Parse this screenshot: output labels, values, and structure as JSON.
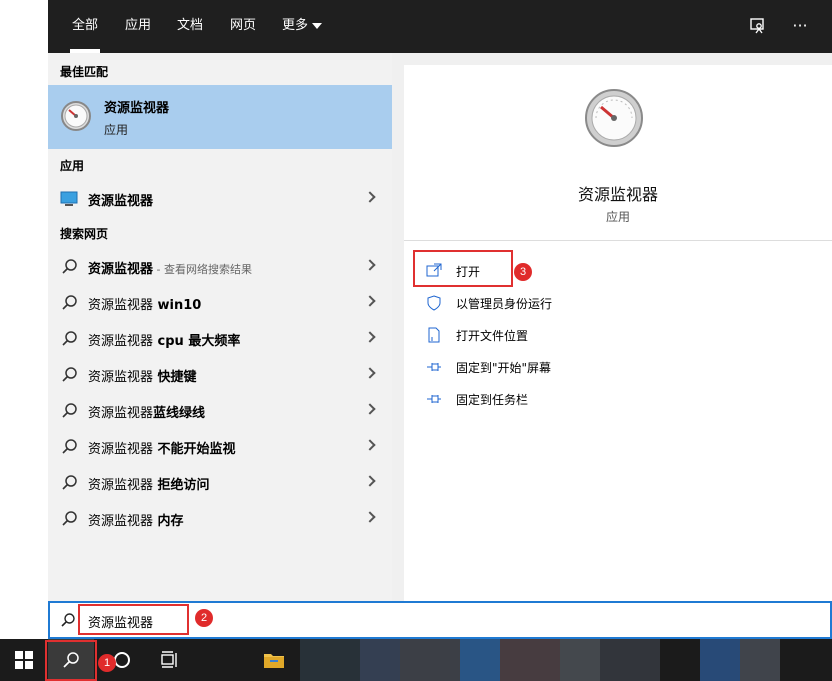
{
  "header": {
    "tabs": [
      {
        "label": "全部",
        "active": true
      },
      {
        "label": "应用"
      },
      {
        "label": "文档"
      },
      {
        "label": "网页"
      },
      {
        "label": "更多"
      }
    ],
    "feedback_icon": "feedback-icon",
    "more_icon": "ellipsis-icon",
    "more_glyph": "···"
  },
  "results": {
    "best_match_label": "最佳匹配",
    "best_match": {
      "title": "资源监视器",
      "subtitle": "应用",
      "icon": "gauge-icon"
    },
    "apps_label": "应用",
    "apps": [
      {
        "title": "资源监视器",
        "icon": "monitor-icon"
      }
    ],
    "web_label": "搜索网页",
    "web": [
      {
        "query": "资源监视器",
        "suffix": "",
        "hint": " - 查看网络搜索结果"
      },
      {
        "query": "资源监视器",
        "suffix": " win10",
        "hint": ""
      },
      {
        "query": "资源监视器",
        "suffix": " cpu 最大频率",
        "hint": ""
      },
      {
        "query": "资源监视器",
        "suffix": " 快捷键",
        "hint": ""
      },
      {
        "query": "资源监视器",
        "suffix": "蓝线绿线",
        "hint": ""
      },
      {
        "query": "资源监视器",
        "suffix": " 不能开始监视",
        "hint": ""
      },
      {
        "query": "资源监视器",
        "suffix": " 拒绝访问",
        "hint": ""
      },
      {
        "query": "资源监视器",
        "suffix": " 内存",
        "hint": ""
      }
    ]
  },
  "detail": {
    "title": "资源监视器",
    "subtitle": "应用",
    "actions": [
      {
        "label": "打开",
        "icon": "open-icon"
      },
      {
        "label": "以管理员身份运行",
        "icon": "shield-icon"
      },
      {
        "label": "打开文件位置",
        "icon": "file-location-icon"
      },
      {
        "label": "固定到\"开始\"屏幕",
        "icon": "pin-icon"
      },
      {
        "label": "固定到任务栏",
        "icon": "pin-icon"
      }
    ]
  },
  "search": {
    "value": "资源监视器",
    "icon": "search-icon"
  },
  "taskbar": {
    "items": [
      "windows-start-icon",
      "search-icon",
      "cortana-circle-icon",
      "task-view-icon",
      "file-explorer-icon"
    ]
  },
  "annotations": {
    "badges": [
      "1",
      "2",
      "3"
    ],
    "color": "#e03030"
  },
  "colors": {
    "topbar": "#1f1f1f",
    "selected": "#a9cdee",
    "accent": "#1f7ad3",
    "taskbar": "#1b1b1b"
  }
}
